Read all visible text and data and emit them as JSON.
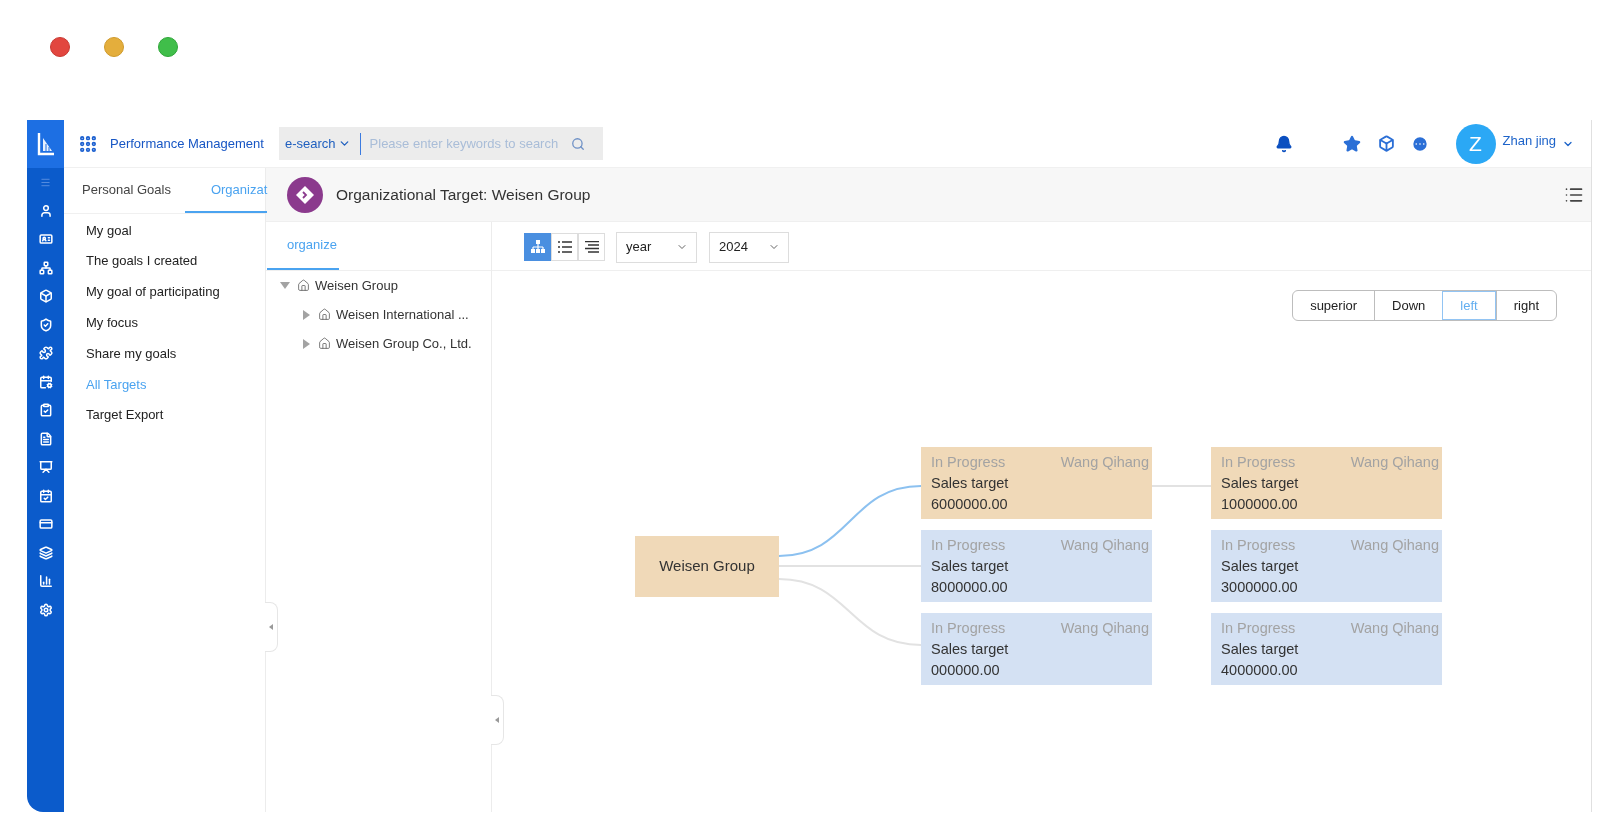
{
  "top_bar": {
    "app_title": "Performance Management",
    "search": {
      "scope": "e-search",
      "placeholder": "Please enter keywords to search"
    },
    "user": {
      "initial": "Z",
      "name": "Zhan jing"
    }
  },
  "nav": {
    "tabs": [
      {
        "label": "Personal Goals",
        "selected": false
      },
      {
        "label": "Organizat",
        "selected": true
      }
    ],
    "items": [
      {
        "label": "My goal",
        "selected": false
      },
      {
        "label": "The goals I created",
        "selected": false
      },
      {
        "label": "My goal of participating",
        "selected": false
      },
      {
        "label": "My focus",
        "selected": false
      },
      {
        "label": "Share my goals",
        "selected": false
      },
      {
        "label": "All Targets",
        "selected": true
      },
      {
        "label": "Target Export",
        "selected": false
      }
    ]
  },
  "header": {
    "title": "Organizational Target: Weisen Group"
  },
  "tree_panel": {
    "tabs": [
      {
        "label": "organize",
        "selected": true
      }
    ],
    "tree": [
      {
        "label": "Weisen Group",
        "expanded": true,
        "children": [
          {
            "label": "Weisen International ...",
            "expanded": false
          },
          {
            "label": "Weisen Group Co., Ltd.",
            "expanded": false
          }
        ]
      }
    ]
  },
  "toolbar": {
    "views": [
      {
        "kind": "org-chart",
        "selected": true
      },
      {
        "kind": "list",
        "selected": false
      },
      {
        "kind": "lines",
        "selected": false
      }
    ],
    "period": "year",
    "year": "2024"
  },
  "direction_buttons": [
    {
      "label": "superior",
      "selected": false
    },
    {
      "label": "Down",
      "selected": false
    },
    {
      "label": "left",
      "selected": true
    },
    {
      "label": "right",
      "selected": false
    }
  ],
  "diagram": {
    "root": {
      "label": "Weisen Group"
    },
    "rows": [
      {
        "linked": true,
        "nodes": [
          {
            "status": "In Progress",
            "owner": "Wang Qihang",
            "name": "Sales target",
            "value": "6000000.00",
            "selected": true
          },
          {
            "status": "In Progress",
            "owner": "Wang Qihang",
            "name": "Sales target",
            "value": "1000000.00",
            "selected": true
          }
        ]
      },
      {
        "linked": false,
        "nodes": [
          {
            "status": "In Progress",
            "owner": "Wang Qihang",
            "name": "Sales target",
            "value": "8000000.00",
            "selected": false
          },
          {
            "status": "In Progress",
            "owner": "Wang Qihang",
            "name": "Sales target",
            "value": "3000000.00",
            "selected": false
          }
        ]
      },
      {
        "linked": false,
        "nodes": [
          {
            "status": "In Progress",
            "owner": "Wang Qihang",
            "name": "Sales target",
            "value": "000000.00",
            "selected": false
          },
          {
            "status": "In Progress",
            "owner": "Wang Qihang",
            "name": "Sales target",
            "value": "4000000.00",
            "selected": false
          }
        ]
      }
    ]
  }
}
